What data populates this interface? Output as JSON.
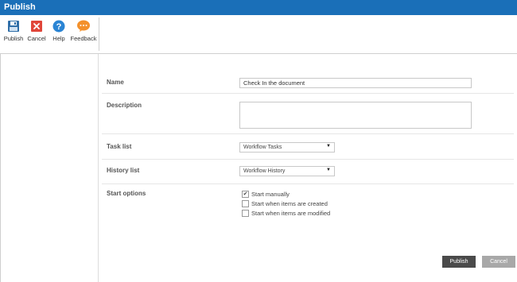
{
  "window": {
    "title": "Publish"
  },
  "ribbon": {
    "buttons": [
      {
        "label": "Publish",
        "icon": "save-icon"
      },
      {
        "label": "Cancel",
        "icon": "close-icon"
      },
      {
        "label": "Help",
        "icon": "help-icon"
      },
      {
        "label": "Feedback",
        "icon": "feedback-icon"
      }
    ]
  },
  "form": {
    "name_label": "Name",
    "name_value": "Check In the document",
    "description_label": "Description",
    "description_value": "",
    "task_list_label": "Task list",
    "task_list_value": "Workflow Tasks",
    "history_list_label": "History list",
    "history_list_value": "Workflow History",
    "start_options_label": "Start options",
    "start_options": [
      {
        "label": "Start manually",
        "checked": true
      },
      {
        "label": "Start when items are created",
        "checked": false
      },
      {
        "label": "Start when items are modified",
        "checked": false
      }
    ]
  },
  "footer": {
    "publish_label": "Publish",
    "cancel_label": "Cancel"
  },
  "colors": {
    "titlebar": "#1a6fb8",
    "save_icon": "#2f6ea8",
    "close_icon": "#e0463a",
    "help_icon": "#2a84d4",
    "feedback_icon": "#f3902b",
    "publish_button": "#4a4a4a",
    "cancel_button": "#a8a8a8"
  }
}
